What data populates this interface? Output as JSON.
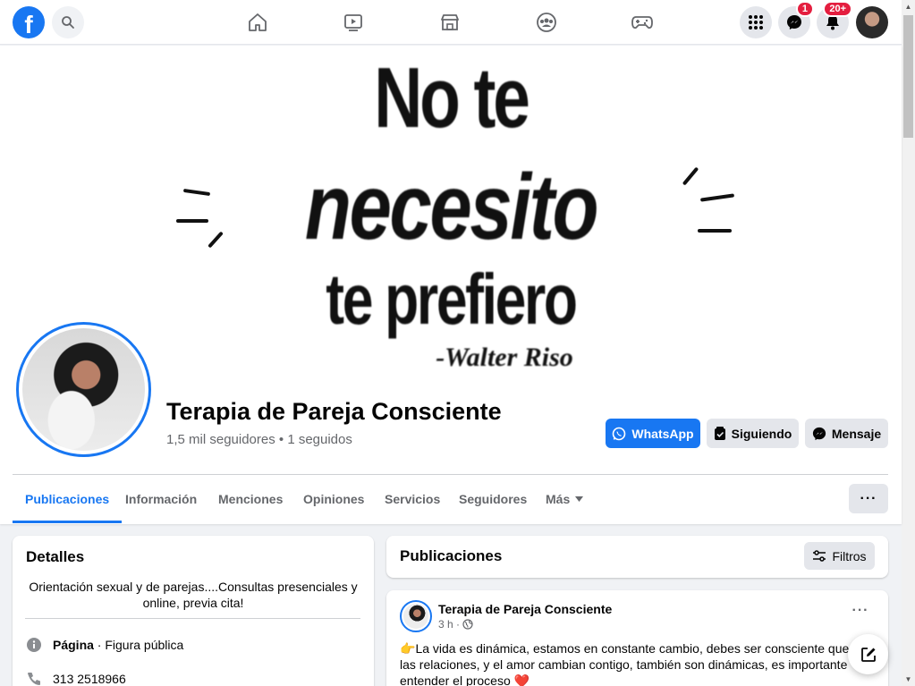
{
  "topbar": {
    "logo_letter": "f",
    "messenger_badge": "1",
    "notifications_badge": "20+"
  },
  "cover": {
    "line1": "No te",
    "line2": "necesito",
    "line3": "te prefiero",
    "line4": "-Walter Riso"
  },
  "page": {
    "name": "Terapia de Pareja Consciente",
    "stats": "1,5 mil seguidores • 1 seguidos"
  },
  "actions": {
    "whatsapp": "WhatsApp",
    "following": "Siguiendo",
    "message": "Mensaje"
  },
  "tabs": {
    "items": [
      "Publicaciones",
      "Información",
      "Menciones",
      "Opiniones",
      "Servicios",
      "Seguidores",
      "Más"
    ],
    "more_dots": "···"
  },
  "details": {
    "title": "Detalles",
    "bio": "Orientación sexual y de parejas....Consultas presenciales y online, previa cita!",
    "category_label": "Página",
    "category_value": " · Figura pública",
    "phone": "313 2518966"
  },
  "posts": {
    "title": "Publicaciones",
    "filters": "Filtros"
  },
  "post": {
    "author": "Terapia de Pareja Consciente",
    "time": "3 h ·",
    "menu": "···",
    "text": "La vida es dinámica, estamos en constante cambio, debes ser consciente que las relaciones, y el amor cambian contigo, también son dinámicas, es importante entender el proceso",
    "emoji_prefix": "👉",
    "emoji_suffix": "❤️"
  },
  "colors": {
    "accent": "#1877f2",
    "badge": "#e41e3f",
    "background": "#f0f2f5"
  }
}
